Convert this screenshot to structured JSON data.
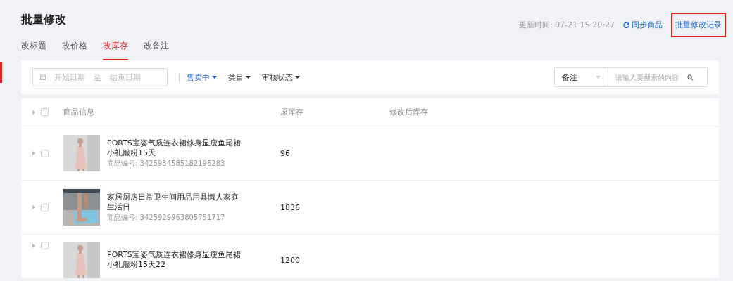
{
  "header": {
    "title": "批量修改",
    "update_time": "更新时间: 07-21 15:20:27",
    "sync_link": "同步商品",
    "record_link": "批量修改记录",
    "record_link_highlighted": true
  },
  "tabs": [
    {
      "label": "改标题",
      "selected": false
    },
    {
      "label": "改价格",
      "selected": false
    },
    {
      "label": "改库存",
      "selected": true
    },
    {
      "label": "改备注",
      "selected": false
    }
  ],
  "filters": {
    "start_placeholder": "开始日期",
    "range_separator": "至",
    "end_placeholder": "结束日期",
    "dropdowns": [
      {
        "label": "售卖中",
        "selected": true
      },
      {
        "label": "类目",
        "selected": false
      },
      {
        "label": "审核状态",
        "selected": false
      }
    ],
    "search_type": "备注",
    "search_placeholder": "请输入要搜索的内容"
  },
  "table": {
    "header_checked": false,
    "columns": [
      "商品信息",
      "原库存",
      "修改后库存"
    ],
    "rows": [
      {
        "checked": false,
        "title": "PORTS宝姿气质连衣裙修身显瘦鱼尾裙小礼服粉15天",
        "product_id": "商品编号: 3425934585182196283",
        "stock": "96"
      },
      {
        "checked": false,
        "title": "家居厨房日常卫生间用品用具懒人家庭生活日",
        "product_id": "商品编号: 3425929963805751717",
        "stock": "1836"
      },
      {
        "checked": false,
        "title": "PORTS宝姿气质连衣裙修身显瘦鱼尾裙小礼服粉15天22",
        "stock": "1200"
      }
    ]
  }
}
